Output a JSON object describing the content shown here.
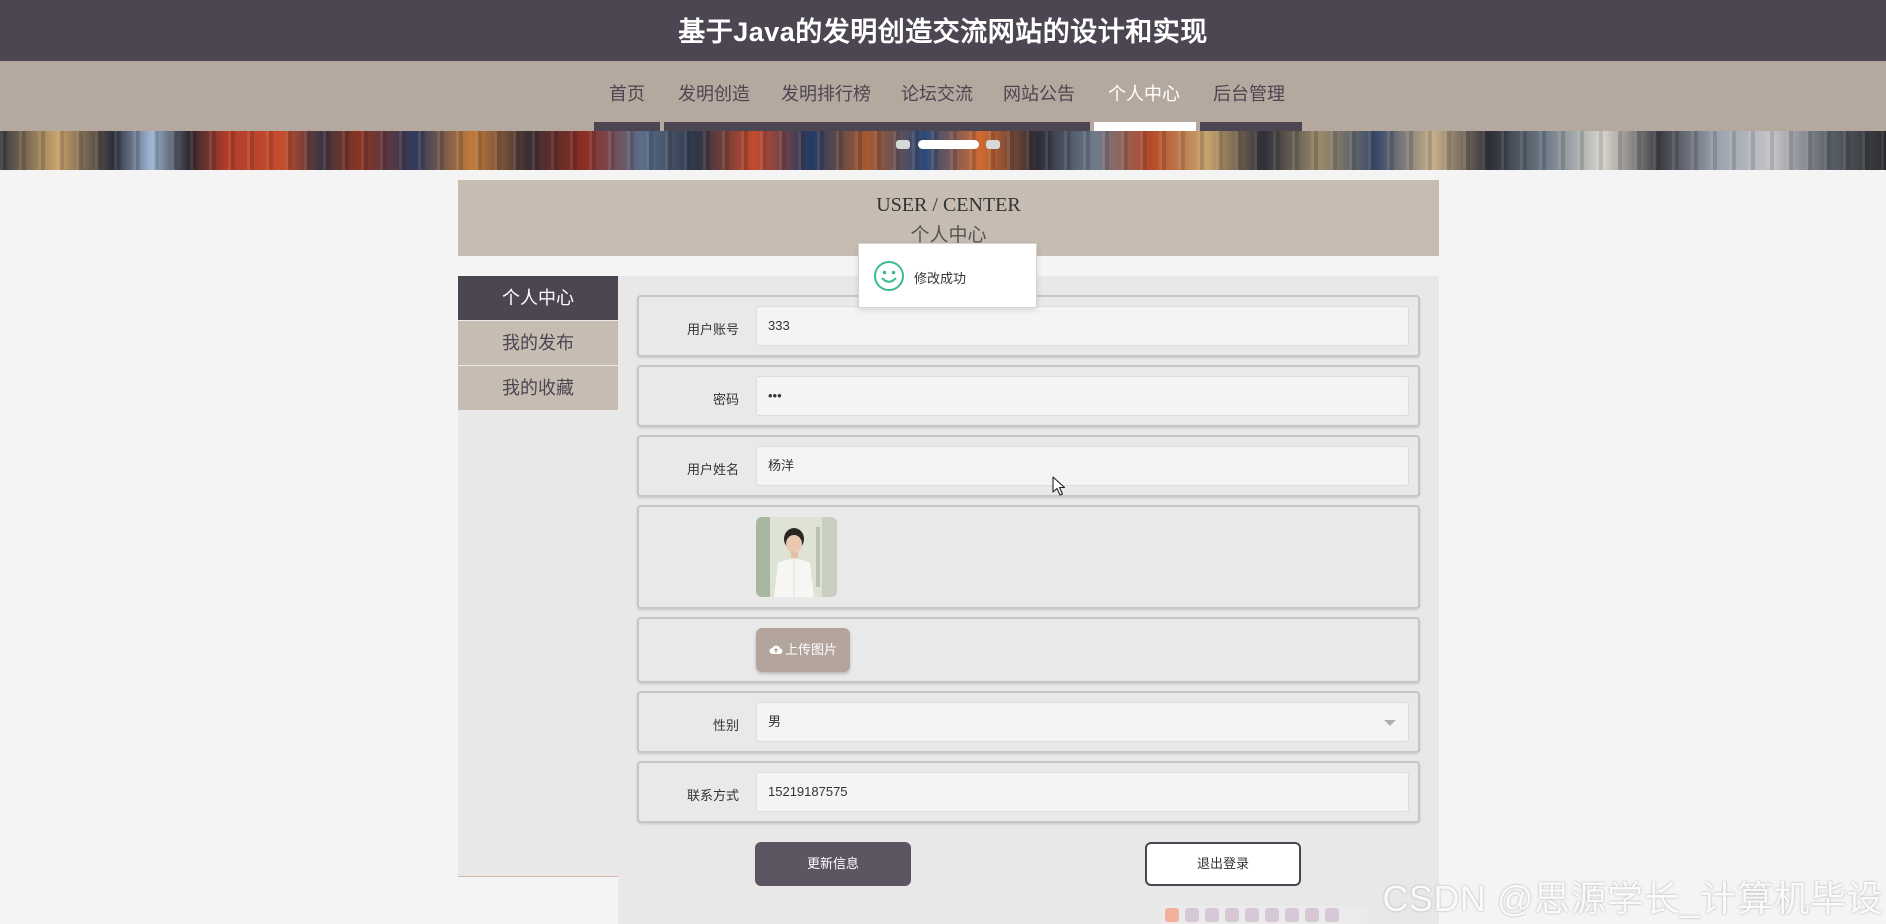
{
  "header": {
    "title": "基于Java的发明创造交流网站的设计和实现"
  },
  "nav": {
    "items": [
      {
        "label": "首页"
      },
      {
        "label": "发明创造"
      },
      {
        "label": "发明排行榜"
      },
      {
        "label": "论坛交流"
      },
      {
        "label": "网站公告"
      },
      {
        "label": "个人中心",
        "active": true
      },
      {
        "label": "后台管理"
      }
    ]
  },
  "banner": {
    "slides": 3,
    "active_slide": 2
  },
  "section": {
    "title_en": "USER / CENTER",
    "title_cn": "个人中心"
  },
  "sidebar": {
    "items": [
      {
        "label": "个人中心",
        "active": true
      },
      {
        "label": "我的发布"
      },
      {
        "label": "我的收藏"
      }
    ]
  },
  "form": {
    "account": {
      "label": "用户账号",
      "value": "333"
    },
    "password": {
      "label": "密码",
      "value": "•••"
    },
    "name": {
      "label": "用户姓名",
      "value": "杨洋"
    },
    "upload_label": "上传图片",
    "gender": {
      "label": "性别",
      "value": "男"
    },
    "phone": {
      "label": "联系方式",
      "value": "15219187575"
    }
  },
  "buttons": {
    "update": "更新信息",
    "logout": "退出登录"
  },
  "toast": {
    "message": "修改成功",
    "icon": "smile-icon"
  },
  "watermark": "CSDN @思源学长_计算机毕设",
  "colors": {
    "header_bg": "#4b4651",
    "nav_bg": "#b5a89e",
    "panel_bg": "#c7bcb1",
    "success": "#3cba92"
  }
}
